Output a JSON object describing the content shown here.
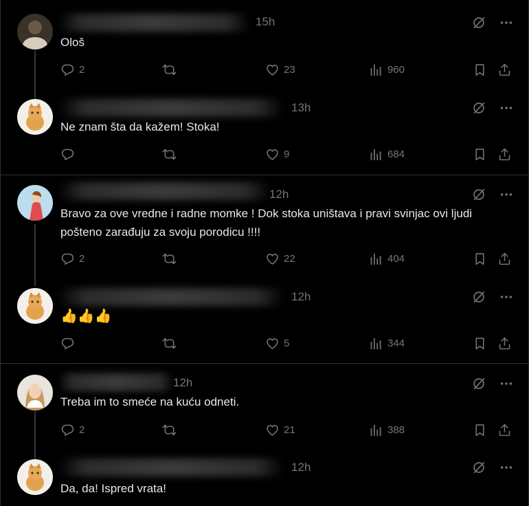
{
  "posts": [
    {
      "time": "15h",
      "text": "Ološ",
      "replies": "2",
      "likes": "23",
      "views": "960"
    },
    {
      "time": "13h",
      "text": "Ne znam šta da kažem! Stoka!",
      "replies": "",
      "likes": "9",
      "views": "684"
    },
    {
      "time": "12h",
      "text": "Bravo za ove vredne i radne momke ! Dok stoka uništava i pravi svinjac ovi ljudi pošteno zarađuju za svoju porodicu !!!!",
      "replies": "2",
      "likes": "22",
      "views": "404"
    },
    {
      "time": "12h",
      "text": "👍👍👍",
      "replies": "",
      "likes": "5",
      "views": "344"
    },
    {
      "time": "12h",
      "text": "Treba im to smeće na kuću odneti.",
      "replies": "2",
      "likes": "21",
      "views": "388"
    },
    {
      "time": "12h",
      "text": "Da, da! Ispred vrata!",
      "replies": "",
      "likes": "",
      "views": ""
    }
  ],
  "colors": {
    "background": "#000000",
    "text": "#e7e9ea",
    "muted": "#71767b",
    "divider": "#2f3336"
  },
  "icons": [
    "reply-icon",
    "retweet-icon",
    "like-icon",
    "views-icon",
    "bookmark-icon",
    "share-icon",
    "grok-icon",
    "more-icon"
  ]
}
